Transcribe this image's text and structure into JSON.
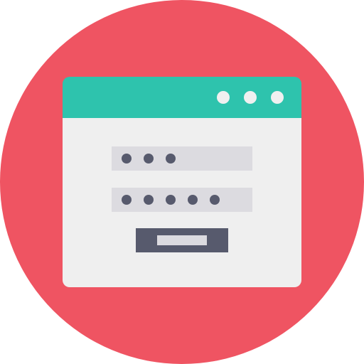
{
  "colors": {
    "badge": "#EF5462",
    "titlebar": "#2EC3AD",
    "window_body": "#EFEFEF",
    "window_dots": "#F0F0F0",
    "field_bg": "#DCDBE0",
    "mask_dots": "#575A6D",
    "button_bg": "#575A6D",
    "button_label_bar": "#DCDBE0"
  },
  "window": {
    "control_dots": [
      "window-dot",
      "window-dot",
      "window-dot"
    ]
  },
  "login_form": {
    "username_mask_count": 3,
    "password_mask_count": 5
  }
}
